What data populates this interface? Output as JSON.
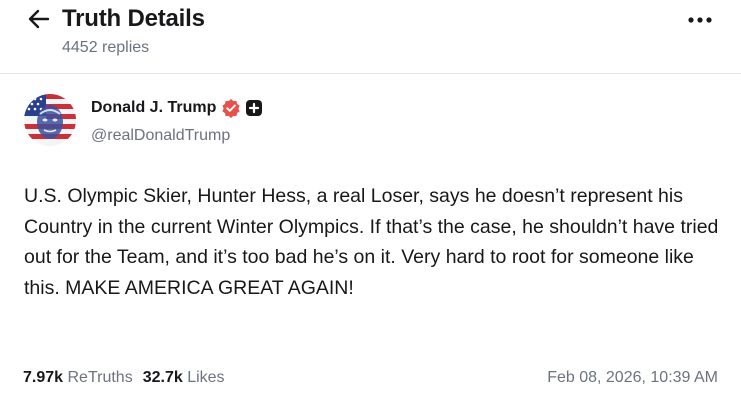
{
  "header": {
    "title": "Truth Details",
    "replies": "4452 replies",
    "back_icon": "arrow-left-icon",
    "more_icon": "more-horizontal-icon"
  },
  "author": {
    "name": "Donald J. Trump",
    "handle": "@realDonaldTrump",
    "verified_icon": "verified-badge-icon",
    "verified_color": "#e8514a",
    "badge_icon": "plus-badge-icon"
  },
  "post": {
    "text": "U.S. Olympic Skier, Hunter Hess, a real Loser, says he doesn’t represent his Country in the current Winter Olympics. If that’s the case, he shouldn’t have tried out for the Team, and it’s too bad he’s on it. Very hard to root for someone like this. MAKE AMERICA GREAT AGAIN!"
  },
  "stats": {
    "retruths_count": "7.97k",
    "retruths_label": "ReTruths",
    "likes_count": "32.7k",
    "likes_label": "Likes",
    "timestamp": "Feb 08, 2026, 10:39 AM"
  }
}
